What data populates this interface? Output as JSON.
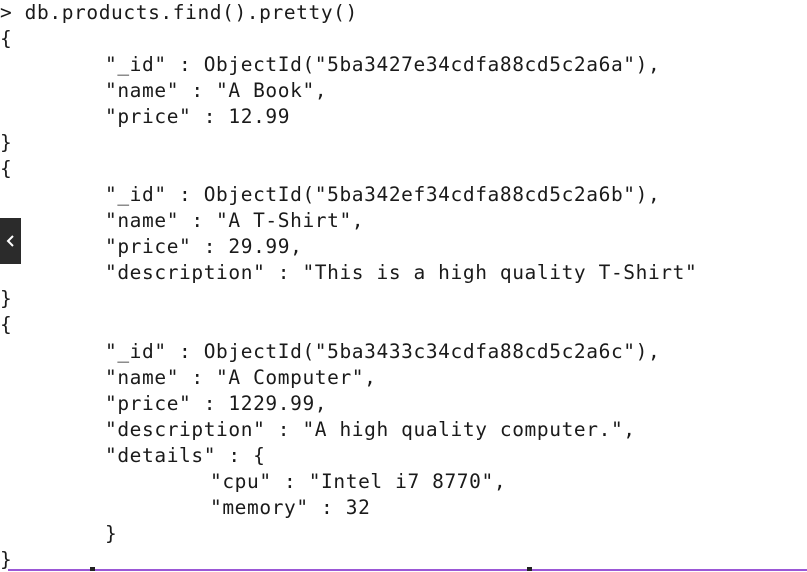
{
  "terminal": {
    "lines": [
      "> db.products.find().pretty()",
      "{",
      "\"_id\" : ObjectId(\"5ba3427e34cdfa88cd5c2a6a\"),",
      "\"name\" : \"A Book\",",
      "\"price\" : 12.99",
      "}",
      "{",
      "\"_id\" : ObjectId(\"5ba342ef34cdfa88cd5c2a6b\"),",
      "\"name\" : \"A T-Shirt\",",
      "\"price\" : 29.99,",
      "\"description\" : \"This is a high quality T-Shirt\"",
      "}",
      "{",
      "\"_id\" : ObjectId(\"5ba3433c34cdfa88cd5c2a6c\"),",
      "\"name\" : \"A Computer\",",
      "\"price\" : 1229.99,",
      "\"description\" : \"A high quality computer.\",",
      "\"details\" : {",
      "\"cpu\" : \"Intel i7 8770\",",
      "\"memory\" : 32",
      "}",
      "}"
    ]
  },
  "back_button": {
    "icon": "chevron-left-icon"
  },
  "colors": {
    "background": "#ffffff",
    "text": "#1a1a1a",
    "scroll_accent": "#9b57d6",
    "button_bg": "#2b2b2b"
  }
}
